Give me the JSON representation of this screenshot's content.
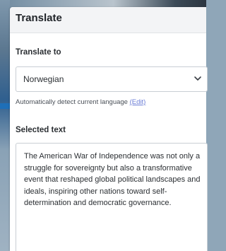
{
  "panel": {
    "title": "Translate"
  },
  "translate_to": {
    "label": "Translate to",
    "selected_language": "Norwegian",
    "chevron_icon": "chevron-down-icon"
  },
  "detect": {
    "text": "Automatically detect current language",
    "link_label": "(Edit)"
  },
  "selected_text": {
    "label": "Selected text",
    "value": "The American War of Independence was not only a struggle for sovereignty but also a transformative event that reshaped global political landscapes and ideals, inspiring other nations toward self-determination and democratic governance."
  },
  "colors": {
    "link": "#6b7dd6",
    "header_bg": "#f3f4f6",
    "border": "#c9ced4"
  }
}
